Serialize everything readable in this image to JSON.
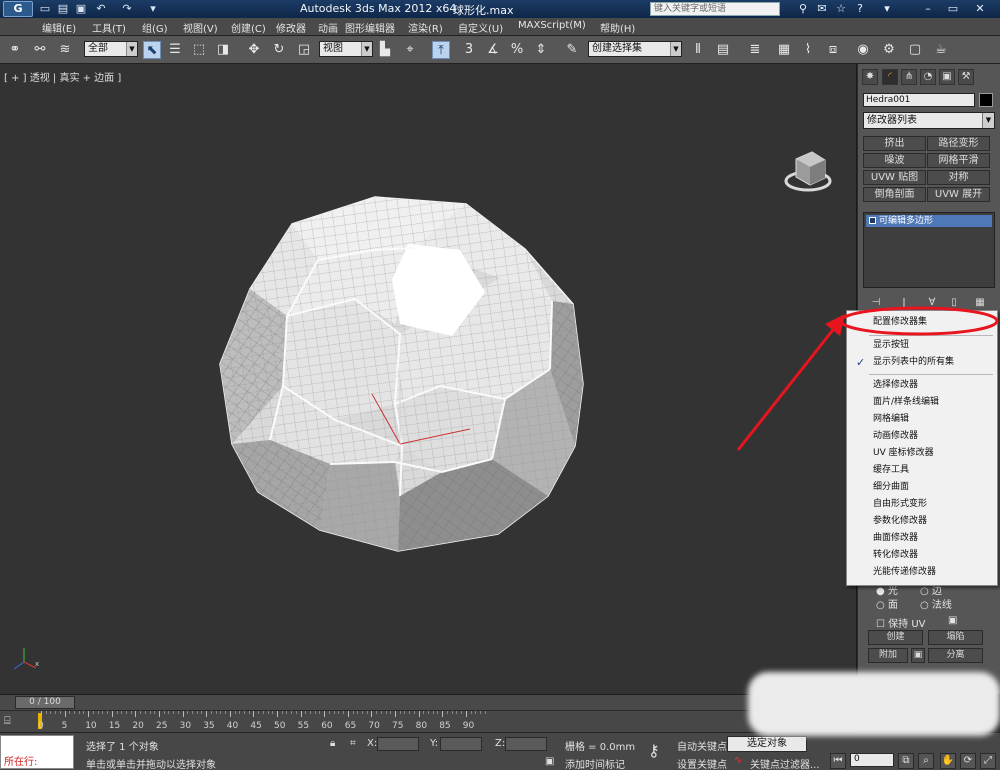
{
  "window": {
    "app_title": "Autodesk 3ds Max  2012 x64",
    "file_name": "球形化.max",
    "search_placeholder": "键入关键字或短语"
  },
  "menu": [
    "编辑(E)",
    "工具(T)",
    "组(G)",
    "视图(V)",
    "创建(C)",
    "修改器",
    "动画",
    "图形编辑器",
    "渲染(R)",
    "自定义(U)",
    "MAXScript(M)",
    "帮助(H)"
  ],
  "toolbar": {
    "selection_filter": "全部",
    "reference_coord": "视图",
    "snap_labels": [
      "3",
      "%"
    ],
    "named_selection": "创建选择集"
  },
  "viewport": {
    "label": "[ + ] 透视 | 真实 + 边面 ]",
    "gizmo_axis_z": "z",
    "gizmo_axis_y": "y",
    "gizmo_axis_x": "x"
  },
  "command_panel": {
    "object_name": "Hedra001",
    "modifier_list": "修改器列表",
    "modifier_buttons": [
      "挤出",
      "路径变形",
      "噪波",
      "网格平滑",
      "UVW 贴图",
      "对称",
      "倒角剖面",
      "UVW 展开"
    ],
    "stack_item": "可编辑多边形"
  },
  "popup_menu": {
    "items": [
      {
        "label": "配置修改器集",
        "checked": false
      },
      {
        "label": "显示按钮",
        "checked": false
      },
      {
        "label": "显示列表中的所有集",
        "checked": true
      },
      {
        "label": "选择修改器",
        "checked": false
      },
      {
        "label": "面片/样条线编辑",
        "checked": false
      },
      {
        "label": "网格编辑",
        "checked": false
      },
      {
        "label": "动画修改器",
        "checked": false
      },
      {
        "label": "UV 座标修改器",
        "checked": false
      },
      {
        "label": "缓存工具",
        "checked": false
      },
      {
        "label": "细分曲面",
        "checked": false
      },
      {
        "label": "自由形式变形",
        "checked": false
      },
      {
        "label": "参数化修改器",
        "checked": false
      },
      {
        "label": "曲面修改器",
        "checked": false
      },
      {
        "label": "转化修改器",
        "checked": false
      },
      {
        "label": "光能传递修改器",
        "checked": false
      }
    ],
    "highlight_color": "#e8141e"
  },
  "rollout": {
    "radio_row1": [
      "光",
      "边"
    ],
    "radio_row2": [
      "面",
      "法线"
    ],
    "keep_uv": "保持 UV",
    "btn_create": "创建",
    "btn_collapse": "塌陷",
    "btn_attach": "附加",
    "btn_detach": "分离"
  },
  "timeline": {
    "frame_display": "0 / 100",
    "tick_labels": [
      "0",
      "5",
      "10",
      "15",
      "20",
      "25",
      "30",
      "35",
      "40",
      "45",
      "50",
      "55",
      "60",
      "65",
      "70",
      "75",
      "80",
      "85",
      "90"
    ]
  },
  "status": {
    "running_label": "所在行:",
    "selected": "选择了 1 个对象",
    "prompt": "单击或单击并拖动以选择对象",
    "x_label": "X:",
    "y_label": "Y:",
    "z_label": "Z:",
    "grid": "栅格 = 0.0mm",
    "add_time_tag": "添加时间标记",
    "auto_key": "自动关键点",
    "set_key": "设置关键点",
    "selection_mode": "选定对象",
    "key_filters": "关键点过滤器...",
    "frame": "0"
  }
}
